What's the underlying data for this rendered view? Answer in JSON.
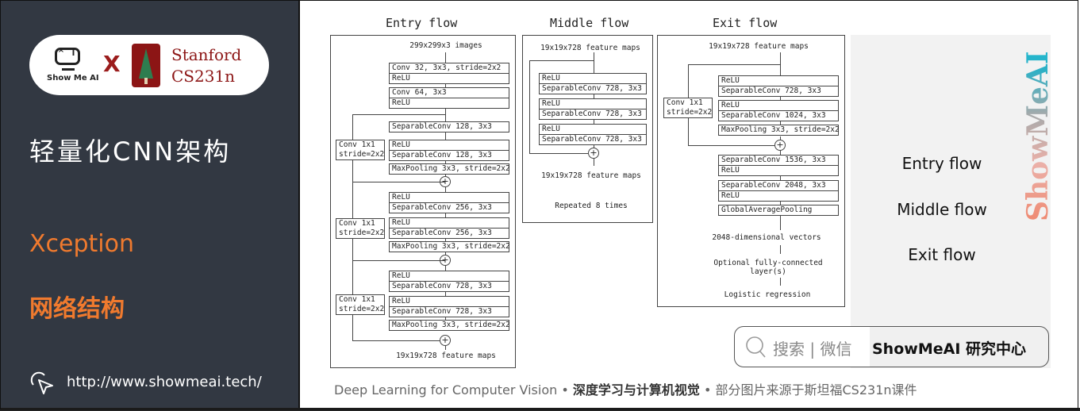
{
  "sidebar": {
    "logo_text": "Show Me AI",
    "logo_face": "^ I",
    "cross": "X",
    "partner_line1": "Stanford",
    "partner_line2": "CS231n",
    "title": "轻量化CNN架构",
    "subtitle1": "Xception",
    "subtitle2": "网络结构",
    "url": "http://www.showmeai.tech/"
  },
  "diagram": {
    "entry": {
      "title": "Entry flow",
      "input": "299x299x3 images",
      "blocks": [
        [
          "Conv 32, 3x3, stride=2x2",
          "ReLU"
        ],
        [
          "Conv 64, 3x3",
          "ReLU"
        ],
        [
          "SeparableConv 128, 3x3"
        ],
        [
          "ReLU",
          "SeparableConv 128, 3x3"
        ],
        [
          "MaxPooling 3x3, stride=2x2"
        ],
        [
          "ReLU",
          "SeparableConv 256, 3x3"
        ],
        [
          "ReLU",
          "SeparableConv 256, 3x3"
        ],
        [
          "MaxPooling 3x3, stride=2x2"
        ],
        [
          "ReLU",
          "SeparableConv 728, 3x3"
        ],
        [
          "ReLU",
          "SeparableConv 728, 3x3"
        ],
        [
          "MaxPooling 3x3, stride=2x2"
        ]
      ],
      "skip_label_1": "Conv 1x1",
      "skip_label_2": "stride=2x2",
      "output": "19x19x728 feature maps"
    },
    "middle": {
      "title": "Middle flow",
      "input": "19x19x728 feature maps",
      "blocks": [
        [
          "ReLU",
          "SeparableConv 728, 3x3"
        ],
        [
          "ReLU",
          "SeparableConv 728, 3x3"
        ],
        [
          "ReLU",
          "SeparableConv 728, 3x3"
        ]
      ],
      "output": "19x19x728 feature maps",
      "note": "Repeated 8 times"
    },
    "exit": {
      "title": "Exit flow",
      "input": "19x19x728 feature maps",
      "blocks": [
        [
          "ReLU",
          "SeparableConv 728, 3x3"
        ],
        [
          "ReLU",
          "SeparableConv 1024, 3x3"
        ],
        [
          "MaxPooling 3x3, stride=2x2"
        ],
        [
          "SeparableConv 1536, 3x3",
          "ReLU"
        ],
        [
          "SeparableConv 2048, 3x3",
          "ReLU"
        ],
        [
          "GlobalAveragePooling"
        ]
      ],
      "skip_label_1": "Conv 1x1",
      "skip_label_2": "stride=2x2",
      "out1": "2048-dimensional vectors",
      "out2a": "Optional fully-connected",
      "out2b": "layer(s)",
      "out3": "Logistic regression"
    },
    "plus": "+"
  },
  "legend": {
    "items": [
      "Entry flow",
      "Middle flow",
      "Exit flow"
    ],
    "brand": "ShowMeAI"
  },
  "search": {
    "label": "搜索 | 微信",
    "brand": "ShowMeAI 研究中心"
  },
  "footer": {
    "part1": "Deep Learning for Computer Vision",
    "sep": " • ",
    "part2": "深度学习与计算机视觉",
    "part3": "部分图片来源于斯坦福CS231n课件"
  },
  "colors": {
    "sidebar_bg": "#323842",
    "accent_orange": "#f07a2e",
    "stanford_red": "#8c1515"
  }
}
